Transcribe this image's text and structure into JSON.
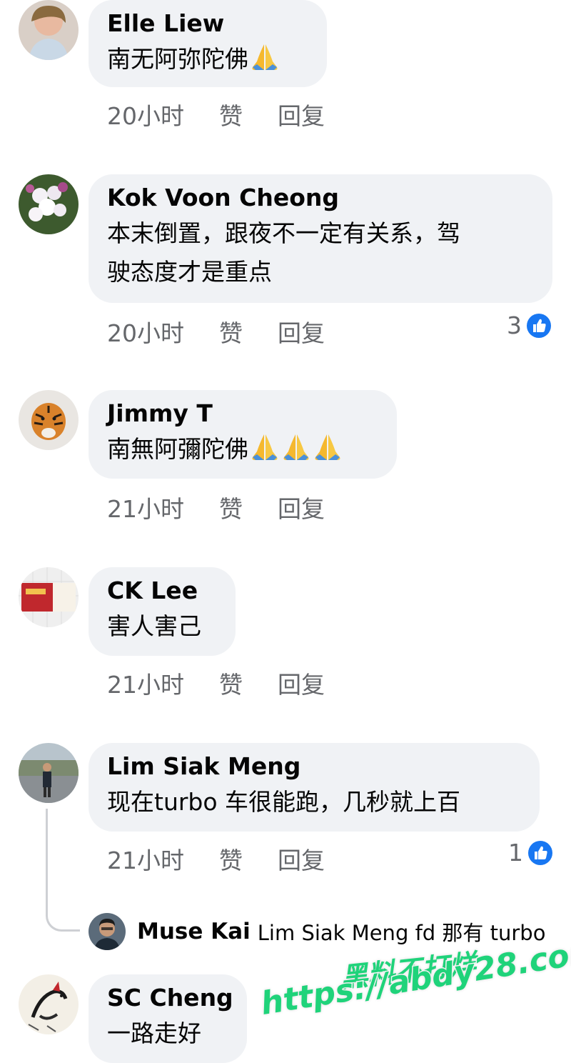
{
  "comments": [
    {
      "name": "Elle Liew",
      "lines": [
        "南无阿弥陀佛"
      ],
      "emoji": [
        "folded-hands"
      ],
      "time": "20小时",
      "like": "赞",
      "reply": "回复"
    },
    {
      "name": "Kok Voon Cheong",
      "lines": [
        "本末倒置，跟夜不一定有关系，驾",
        "驶态度才是重点"
      ],
      "time": "20小时",
      "like": "赞",
      "reply": "回复",
      "reaction_count": "3"
    },
    {
      "name": "Jimmy T",
      "lines": [
        "南無阿彌陀佛"
      ],
      "emoji": [
        "folded-hands",
        "folded-hands",
        "folded-hands"
      ],
      "time": "21小时",
      "like": "赞",
      "reply": "回复"
    },
    {
      "name": "CK Lee",
      "lines": [
        "害人害己"
      ],
      "time": "21小时",
      "like": "赞",
      "reply": "回复"
    },
    {
      "name": "Lim Siak Meng",
      "lines": [
        "现在turbo 车很能跑，几秒就上百"
      ],
      "time": "21小时",
      "like": "赞",
      "reply": "回复",
      "reaction_count": "1"
    },
    {
      "name": "SC Cheng",
      "lines": [
        "一路走好"
      ]
    }
  ],
  "reply_preview": {
    "name": "Muse Kai",
    "text": "Lim Siak Meng fd 那有 turbo"
  },
  "watermark": {
    "line1": "黑料不打烊",
    "line2": "https://abdy28.com"
  },
  "colors": {
    "bubble": "#f0f2f5",
    "meta_text": "#65676b",
    "like_blue": "#1877f2",
    "watermark_green": "#1fd37a"
  }
}
